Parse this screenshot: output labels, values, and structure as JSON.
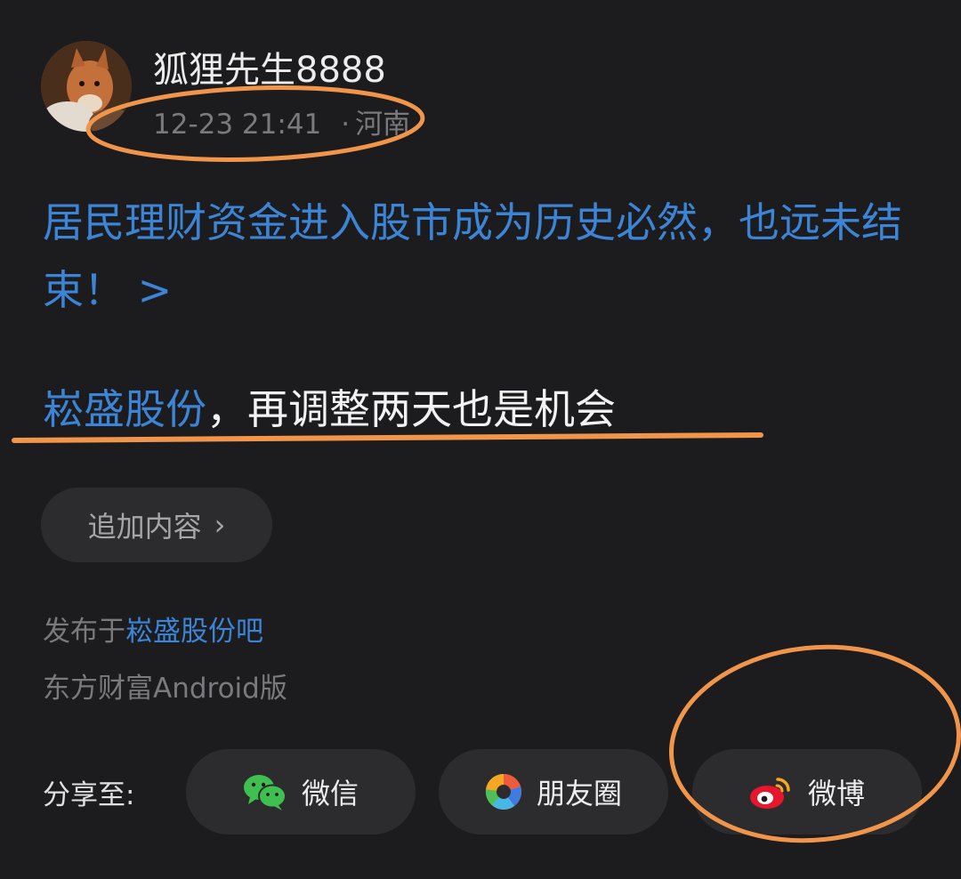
{
  "post": {
    "author": "狐狸先生8888",
    "time": "12-23 21:41",
    "location": "河南",
    "headline": "居民理财资金进入股市成为历史必然，也远未结束！ >",
    "statement_stock": "崧盛股份",
    "statement_rest": "，再调整两天也是机会",
    "add_content_label": "追加内容",
    "posted_prefix": "发布于",
    "posted_bar": "崧盛股份吧",
    "client": "东方财富Android版"
  },
  "share": {
    "label": "分享至:",
    "targets": [
      {
        "label": "微信",
        "icon": "wechat-icon"
      },
      {
        "label": "朋友圈",
        "icon": "moments-icon"
      },
      {
        "label": "微博",
        "icon": "weibo-icon"
      }
    ]
  },
  "colors": {
    "background": "#1c1c1e",
    "link": "#3c85d6",
    "pill": "#2c2c2e",
    "annotation": "#f0954a"
  }
}
